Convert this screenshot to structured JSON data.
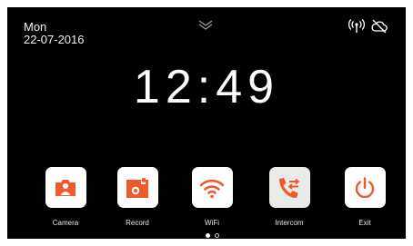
{
  "status": {
    "day": "Mon",
    "date": "22-07-2016",
    "icons": [
      "antenna-signal-icon",
      "cloud-off-icon"
    ]
  },
  "clock": {
    "time": "12:49"
  },
  "apps": [
    {
      "label": "Camera",
      "icon": "camera-icon"
    },
    {
      "label": "Record",
      "icon": "record-icon"
    },
    {
      "label": "WiFi",
      "icon": "wifi-icon"
    },
    {
      "label": "Intercom",
      "icon": "intercom-phone-icon"
    },
    {
      "label": "Exit",
      "icon": "power-icon"
    }
  ],
  "pager": {
    "pages": 2,
    "current": 1
  },
  "colors": {
    "background": "#000000",
    "accent": "#ef5a2c",
    "tile": "#ffffff",
    "tile_alt": "#e9ece6",
    "text": "#ffffff"
  }
}
